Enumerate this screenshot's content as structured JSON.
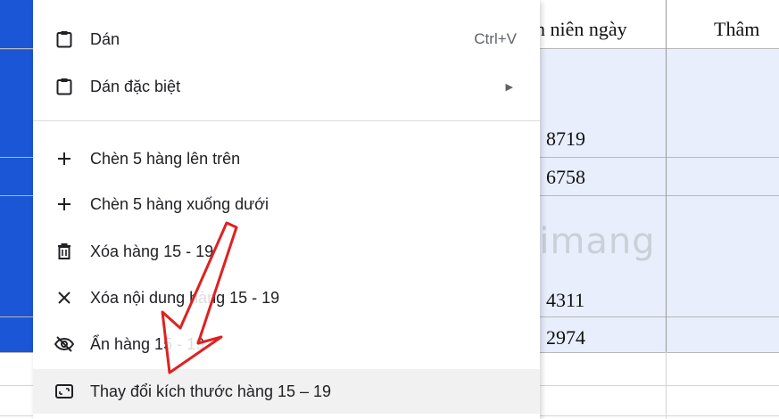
{
  "header": {
    "col_b": "n niên ngày",
    "col_c": "Thâm"
  },
  "cells": [
    "8719",
    "6758",
    "4311",
    "2974"
  ],
  "menu": {
    "paste": {
      "label": "Dán",
      "shortcut": "Ctrl+V"
    },
    "paste_special": {
      "label": "Dán đặc biệt"
    },
    "insert_above": {
      "label": "Chèn 5 hàng lên trên"
    },
    "insert_below": {
      "label": "Chèn 5 hàng xuống dưới"
    },
    "delete_rows": {
      "label": "Xóa hàng 15 - 19"
    },
    "clear_rows": {
      "label": "Xóa nội dung hàng 15 - 19"
    },
    "hide_rows": {
      "label": "Ẩn hàng 15 - 19"
    },
    "resize_rows": {
      "label": "Thay đổi kích thước hàng 15 – 19"
    }
  },
  "watermark": "uantrimang",
  "colors": {
    "selection": "#1a56d6",
    "arrow": "#e02020"
  }
}
